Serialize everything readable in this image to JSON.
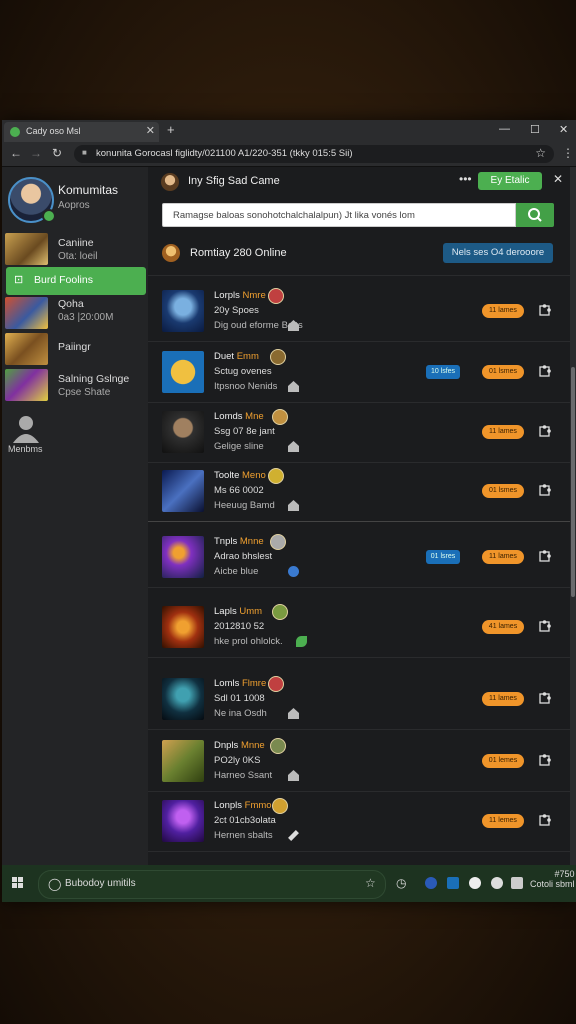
{
  "browser": {
    "tab_title": "Cady oso Msl",
    "tab_close": "✕",
    "new_tab": "+",
    "url": "konunita Gorocasl figlidty/021100 A1/220-351 (tkky 015:5 Sii)",
    "controls": {
      "minimize": "—",
      "maximize": "☐",
      "close": "✕"
    }
  },
  "sidebar": {
    "profile": {
      "name": "Komumitas",
      "sub": "Aopros"
    },
    "items": [
      {
        "label": "Caniine",
        "sub": "Ota: loeil"
      },
      {
        "label": "Burd Foolins",
        "active": true
      },
      {
        "label": "Qoha",
        "sub": "0a3 |20:00M"
      },
      {
        "label": "Paiingr"
      },
      {
        "label": "Salning Gslnge",
        "sub": "Cpse Shate"
      }
    ],
    "members_label": "Menbms"
  },
  "main": {
    "header": {
      "title": "Iny Sfig Sad Came",
      "button": "Ey Etalic"
    },
    "search": {
      "placeholder": "Ramagse baloas sonohotchalchalalpun) Jt lika vonés lom"
    },
    "online": {
      "label": "Romtiay 280 Online",
      "button": "Nels ses O4 derooore"
    }
  },
  "rows": [
    {
      "name": "Lorpls",
      "tag": "Nmre",
      "line2": "20y Spoes",
      "line3": "Dig oud eforme Baits",
      "blue": "",
      "orange": "11 lames"
    },
    {
      "name": "Duet",
      "tag": "Emm",
      "line2": "Sctug ovenes",
      "line3": "Itpsnoo Nenids",
      "blue": "10 lsfes",
      "orange": "01 lsmes"
    },
    {
      "name": "Lomds",
      "tag": "Mne",
      "line2": "Ssg 07 8e jant",
      "line3": "Gelige sline",
      "blue": "",
      "orange": "11 lames"
    },
    {
      "name": "Toolte",
      "tag": "Meno",
      "line2": "Ms 66 0002",
      "line3": "Heeuug Bamd",
      "blue": "",
      "orange": "01 lsmes"
    },
    {
      "name": "Tnpls",
      "tag": "Mnne",
      "line2": "Adrao bhslest",
      "line3": "Aicbe blue",
      "blue": "01 lsres",
      "orange": "11 lames"
    },
    {
      "name": "Lapls",
      "tag": "Umm",
      "line2": "2012810 52",
      "line3": "hke prol ohlolck.",
      "blue": "",
      "orange": "41 lames"
    },
    {
      "name": "Lomls",
      "tag": "Flmre",
      "line2": "Sdl 01 1008",
      "line3": "Ne ina Osdh",
      "blue": "",
      "orange": "11 lames"
    },
    {
      "name": "Dnpls",
      "tag": "Mnne",
      "line2": "PO2ly 0KS",
      "line3": "Harneo Ssant",
      "blue": "",
      "orange": "01 lemes"
    },
    {
      "name": "Lonpls",
      "tag": "Fmmo",
      "line2": "2ct 01cb3olata",
      "line3": "Hernen sbalts",
      "blue": "",
      "orange": "11 lemes"
    }
  ],
  "taskbar": {
    "search_text": "Bubodoy umitils",
    "time": "#750",
    "date": "Cotoli sbml"
  },
  "colors": {
    "accent": "#4caf50",
    "orange": "#f0952a",
    "blue": "#1a6fb8"
  }
}
